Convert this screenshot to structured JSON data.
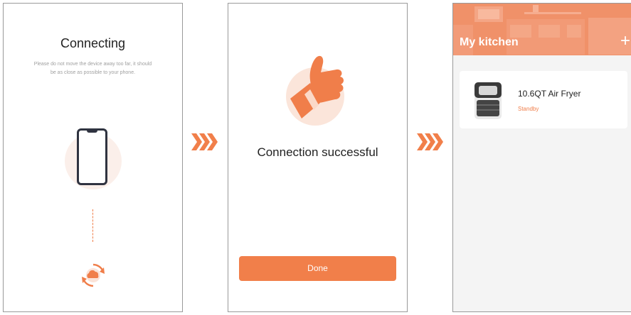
{
  "screen1": {
    "title": "Connecting",
    "subtitle": "Please do not move the device away too far, it should be as close as possible to your phone."
  },
  "screen2": {
    "message": "Connection successful",
    "done_label": "Done"
  },
  "screen3": {
    "title": "My kitchen",
    "add_symbol": "+",
    "devices": [
      {
        "name": "10.6QT Air Fryer",
        "status": "Standby"
      }
    ]
  },
  "colors": {
    "accent": "#f17f4a",
    "header": "#f09169",
    "dark": "#2f3340"
  },
  "icons": [
    "phone-icon",
    "cloud-sync-icon",
    "thumbs-up-icon",
    "chevron-right-icon",
    "air-fryer-icon",
    "plus-icon"
  ]
}
